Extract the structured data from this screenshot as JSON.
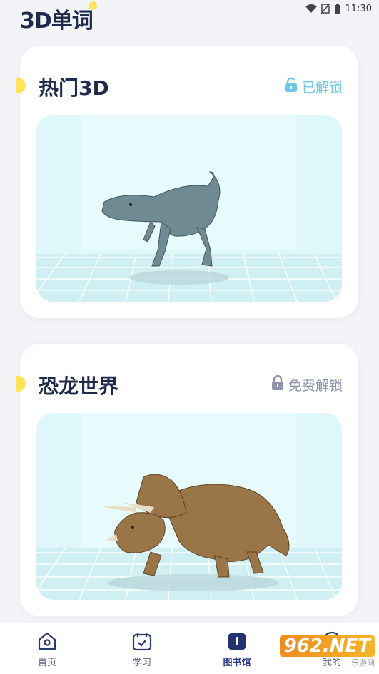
{
  "status_bar": {
    "time": "11:30"
  },
  "app": {
    "title": "3D单词"
  },
  "cards": [
    {
      "title": "热门3D",
      "status": "已解锁",
      "lock_state": "unlocked",
      "accent_color": "#6cc7e8",
      "image": "t-rex-3d-model"
    },
    {
      "title": "恐龙世界",
      "status": "免费解锁",
      "lock_state": "locked",
      "accent_color": "#8d93a8",
      "image": "triceratops-3d-model"
    }
  ],
  "tabs": [
    {
      "label": "首页",
      "icon": "home-icon"
    },
    {
      "label": "学习",
      "icon": "calendar-check-icon"
    },
    {
      "label": "图书馆",
      "icon": "book-icon",
      "active": true
    },
    {
      "label": "我的",
      "icon": "profile-icon"
    }
  ],
  "watermark": {
    "main": "962.NET",
    "sub": "乐游网"
  },
  "colors": {
    "accent_yellow": "#ffe35a",
    "title_dark": "#1f2a4d",
    "unlocked": "#6cc7e8",
    "locked": "#8d93a8"
  }
}
